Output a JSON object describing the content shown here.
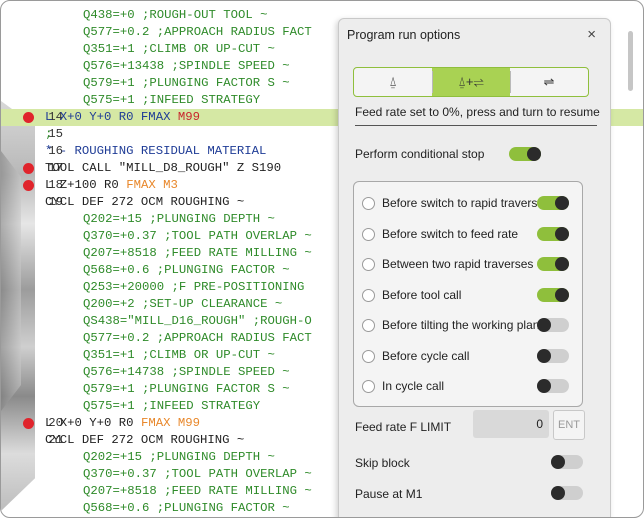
{
  "code": {
    "lines": [
      {
        "no": "",
        "text": "Q438=+0 ;ROUGH-OUT TOOL ~",
        "cls": "c-green",
        "indent": true,
        "bp": false,
        "hl": false
      },
      {
        "no": "",
        "text": "Q577=+0.2 ;APPROACH RADIUS FACT",
        "cls": "c-green",
        "indent": true,
        "bp": false,
        "hl": false
      },
      {
        "no": "",
        "text": "Q351=+1 ;CLIMB OR UP-CUT ~",
        "cls": "c-green",
        "indent": true,
        "bp": false,
        "hl": false
      },
      {
        "no": "",
        "text": "Q576=+13438 ;SPINDLE SPEED ~",
        "cls": "c-green",
        "indent": true,
        "bp": false,
        "hl": false
      },
      {
        "no": "",
        "text": "Q579=+1 ;PLUNGING FACTOR S ~",
        "cls": "c-green",
        "indent": true,
        "bp": false,
        "hl": false
      },
      {
        "no": "",
        "text": "Q575=+1 ;INFEED STRATEGY",
        "cls": "c-green",
        "indent": true,
        "bp": false,
        "hl": false
      },
      {
        "no": "14",
        "text": "L X+0 Y+0 R0 FMAX M99",
        "cls": "c-blue",
        "indent": false,
        "bp": true,
        "hl": true
      },
      {
        "no": "15",
        "text": ";",
        "cls": "c-green",
        "indent": false,
        "bp": false,
        "hl": false
      },
      {
        "no": "16",
        "text": "* - ROUGHING RESIDUAL MATERIAL",
        "cls": "c-blue",
        "indent": false,
        "bp": false,
        "hl": false
      },
      {
        "no": "17",
        "text": "TOOL CALL \"MILL_D8_ROUGH\" Z S190",
        "cls": "c-dark",
        "indent": false,
        "bp": true,
        "hl": false
      },
      {
        "no": "18",
        "text": "L Z+100 R0 FMAX M3",
        "cls": "c-dark",
        "indent": false,
        "bp": true,
        "hl": false
      },
      {
        "no": "19",
        "text": "CYCL DEF 272 OCM ROUGHING ~",
        "cls": "c-dark",
        "indent": false,
        "bp": false,
        "hl": false
      },
      {
        "no": "",
        "text": "Q202=+15 ;PLUNGING DEPTH ~",
        "cls": "c-green",
        "indent": true,
        "bp": false,
        "hl": false
      },
      {
        "no": "",
        "text": "Q370=+0.37 ;TOOL PATH OVERLAP ~",
        "cls": "c-green",
        "indent": true,
        "bp": false,
        "hl": false
      },
      {
        "no": "",
        "text": "Q207=+8518 ;FEED RATE MILLING ~",
        "cls": "c-green",
        "indent": true,
        "bp": false,
        "hl": false
      },
      {
        "no": "",
        "text": "Q568=+0.6 ;PLUNGING FACTOR ~",
        "cls": "c-green",
        "indent": true,
        "bp": false,
        "hl": false
      },
      {
        "no": "",
        "text": "Q253=+20000 ;F PRE-POSITIONING",
        "cls": "c-green",
        "indent": true,
        "bp": false,
        "hl": false
      },
      {
        "no": "",
        "text": "Q200=+2 ;SET-UP CLEARANCE ~",
        "cls": "c-green",
        "indent": true,
        "bp": false,
        "hl": false
      },
      {
        "no": "",
        "text": "QS438=\"MILL_D16_ROUGH\" ;ROUGH-O",
        "cls": "c-green",
        "indent": true,
        "bp": false,
        "hl": false
      },
      {
        "no": "",
        "text": "Q577=+0.2 ;APPROACH RADIUS FACT",
        "cls": "c-green",
        "indent": true,
        "bp": false,
        "hl": false
      },
      {
        "no": "",
        "text": "Q351=+1 ;CLIMB OR UP-CUT ~",
        "cls": "c-green",
        "indent": true,
        "bp": false,
        "hl": false
      },
      {
        "no": "",
        "text": "Q576=+14738 ;SPINDLE SPEED ~",
        "cls": "c-green",
        "indent": true,
        "bp": false,
        "hl": false
      },
      {
        "no": "",
        "text": "Q579=+1 ;PLUNGING FACTOR S ~",
        "cls": "c-green",
        "indent": true,
        "bp": false,
        "hl": false
      },
      {
        "no": "",
        "text": "Q575=+1 ;INFEED STRATEGY",
        "cls": "c-green",
        "indent": true,
        "bp": false,
        "hl": false
      },
      {
        "no": "20",
        "text": "L X+0 Y+0 R0 FMAX M99",
        "cls": "c-dark",
        "indent": false,
        "bp": true,
        "hl": false
      },
      {
        "no": "21",
        "text": "CYCL DEF 272 OCM ROUGHING ~",
        "cls": "c-dark",
        "indent": false,
        "bp": false,
        "hl": false
      },
      {
        "no": "",
        "text": "Q202=+15 ;PLUNGING DEPTH ~",
        "cls": "c-green",
        "indent": true,
        "bp": false,
        "hl": false
      },
      {
        "no": "",
        "text": "Q370=+0.37 ;TOOL PATH OVERLAP ~",
        "cls": "c-green",
        "indent": true,
        "bp": false,
        "hl": false
      },
      {
        "no": "",
        "text": "Q207=+8518 ;FEED RATE MILLING ~",
        "cls": "c-green",
        "indent": true,
        "bp": false,
        "hl": false
      },
      {
        "no": "",
        "text": "Q568=+0.6 ;PLUNGING FACTOR ~",
        "cls": "c-green",
        "indent": true,
        "bp": false,
        "hl": false
      }
    ]
  },
  "dialog": {
    "title": "Program run options",
    "close_label": "×",
    "modes": [
      {
        "icon": "⍙",
        "name": "mode-stop-icon"
      },
      {
        "icon": "⍙+⇌",
        "name": "mode-stop-feed-icon"
      },
      {
        "icon": "⇌",
        "name": "mode-feed-icon"
      }
    ],
    "active_mode": 1,
    "info_text": "Feed rate set to 0%, press and turn to resume",
    "conditional_stop": {
      "label": "Perform conditional stop",
      "on": true
    },
    "options": [
      {
        "label": "Before switch to rapid traverse",
        "on": true
      },
      {
        "label": "Before switch to feed rate",
        "on": true
      },
      {
        "label": "Between two rapid traverses",
        "on": true
      },
      {
        "label": "Before tool call",
        "on": true
      },
      {
        "label": "Before tilting the working plane",
        "on": false
      },
      {
        "label": "Before cycle call",
        "on": false
      },
      {
        "label": "In cycle call",
        "on": false
      }
    ],
    "feed_limit": {
      "label": "Feed rate F LIMIT",
      "value": "0",
      "ent_label": "ENT"
    },
    "skip_block": {
      "label": "Skip block",
      "on": false
    },
    "pause_m1": {
      "label": "Pause at M1",
      "on": false
    }
  },
  "colors": {
    "accent": "#a9d253",
    "highlight": "#d5e8a4",
    "breakpoint": "#e0242c"
  }
}
